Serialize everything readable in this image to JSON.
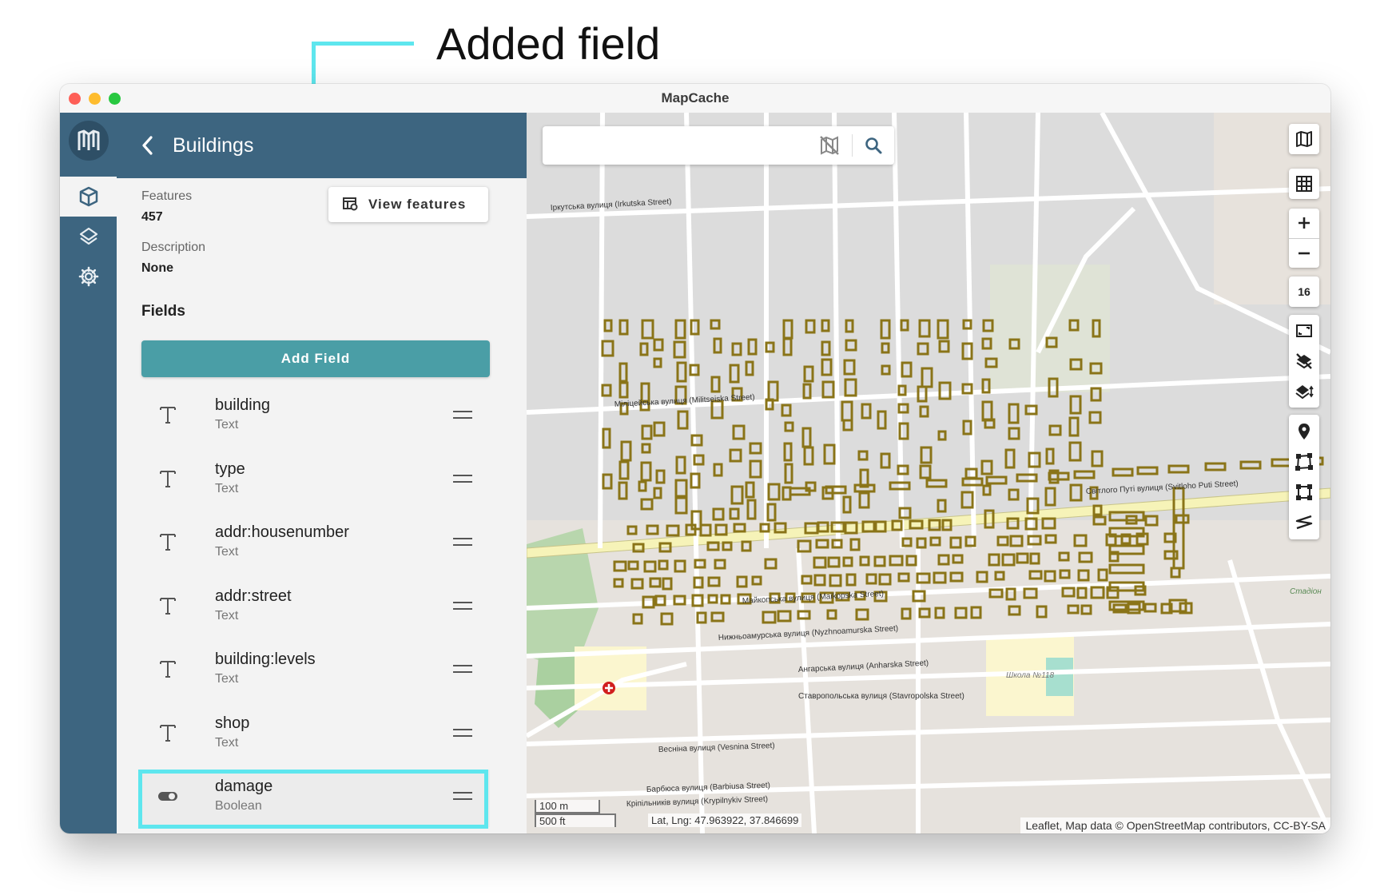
{
  "annotation": {
    "text": "Added field"
  },
  "window": {
    "title": "MapCache"
  },
  "panel": {
    "title": "Buildings",
    "features_label": "Features",
    "features_value": "457",
    "description_label": "Description",
    "description_value": "None",
    "view_features_label": "View features",
    "fields_heading": "Fields",
    "add_field_label": "Add Field",
    "fields": [
      {
        "name": "building",
        "type": "Text",
        "icon": "text-type-icon"
      },
      {
        "name": "type",
        "type": "Text",
        "icon": "text-type-icon"
      },
      {
        "name": "addr:housenumber",
        "type": "Text",
        "icon": "text-type-icon"
      },
      {
        "name": "addr:street",
        "type": "Text",
        "icon": "text-type-icon"
      },
      {
        "name": "building:levels",
        "type": "Text",
        "icon": "text-type-icon"
      },
      {
        "name": "shop",
        "type": "Text",
        "icon": "text-type-icon"
      },
      {
        "name": "damage",
        "type": "Boolean",
        "icon": "toggle-type-icon"
      }
    ]
  },
  "map": {
    "zoom": "16",
    "scale_m": "100 m",
    "scale_ft": "500 ft",
    "latlng": "Lat, Lng: 47.963922, 37.846699",
    "attribution": "Leaflet, Map data © OpenStreetMap contributors, CC-BY-SA",
    "labels": [
      "Іркутська вулиця (Irkutska Street)",
      "Міліцейська вулиця (Militseiska Street)",
      "Світлого Путі вулиця (Svitloho Puti Street)",
      "Майкопська вулиця (Maikopska Street)",
      "Нижньоамурська вулиця (Nyzhnoamurska Street)",
      "Ангарська вулиця (Anharska Street)",
      "Ставропольська вулиця (Stavropolska Street)",
      "Весніна вулиця (Vesnina Street)",
      "Барбюса вулиця (Barbiusa Street)",
      "Кріпільників вулиця (Krypilnykiv Street)",
      "Школа №118",
      "Стадіон"
    ]
  },
  "colors": {
    "rail": "#3d6580",
    "accent": "#4a9ea6",
    "highlight": "#5ee6ee",
    "building": "#8a7418"
  }
}
